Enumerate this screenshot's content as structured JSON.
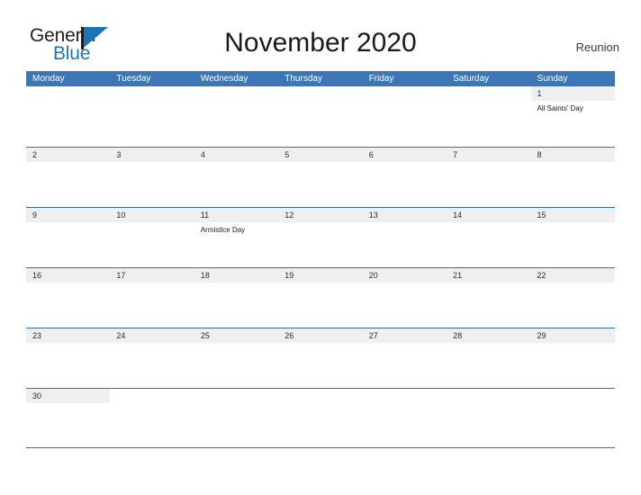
{
  "logo": {
    "word_top": "General",
    "word_bottom": "Blue",
    "sail_icon": "sail-triangle-icon",
    "brand_blue": "#1b75bb"
  },
  "header": {
    "title": "November 2020",
    "locale": "Reunion"
  },
  "theme": {
    "header_blue": "#3b77b8",
    "rule_blue": "#2f6fad",
    "band_gray": "#efefef"
  },
  "calendar": {
    "weekdays": [
      "Monday",
      "Tuesday",
      "Wednesday",
      "Thursday",
      "Friday",
      "Saturday",
      "Sunday"
    ],
    "weeks": [
      [
        {
          "date": "",
          "event": ""
        },
        {
          "date": "",
          "event": ""
        },
        {
          "date": "",
          "event": ""
        },
        {
          "date": "",
          "event": ""
        },
        {
          "date": "",
          "event": ""
        },
        {
          "date": "",
          "event": ""
        },
        {
          "date": "1",
          "event": "All Saints' Day"
        }
      ],
      [
        {
          "date": "2",
          "event": ""
        },
        {
          "date": "3",
          "event": ""
        },
        {
          "date": "4",
          "event": ""
        },
        {
          "date": "5",
          "event": ""
        },
        {
          "date": "6",
          "event": ""
        },
        {
          "date": "7",
          "event": ""
        },
        {
          "date": "8",
          "event": ""
        }
      ],
      [
        {
          "date": "9",
          "event": ""
        },
        {
          "date": "10",
          "event": ""
        },
        {
          "date": "11",
          "event": "Armistice Day"
        },
        {
          "date": "12",
          "event": ""
        },
        {
          "date": "13",
          "event": ""
        },
        {
          "date": "14",
          "event": ""
        },
        {
          "date": "15",
          "event": ""
        }
      ],
      [
        {
          "date": "16",
          "event": ""
        },
        {
          "date": "17",
          "event": ""
        },
        {
          "date": "18",
          "event": ""
        },
        {
          "date": "19",
          "event": ""
        },
        {
          "date": "20",
          "event": ""
        },
        {
          "date": "21",
          "event": ""
        },
        {
          "date": "22",
          "event": ""
        }
      ],
      [
        {
          "date": "23",
          "event": ""
        },
        {
          "date": "24",
          "event": ""
        },
        {
          "date": "25",
          "event": ""
        },
        {
          "date": "26",
          "event": ""
        },
        {
          "date": "27",
          "event": ""
        },
        {
          "date": "28",
          "event": ""
        },
        {
          "date": "29",
          "event": ""
        }
      ],
      [
        {
          "date": "30",
          "event": ""
        },
        {
          "date": "",
          "event": ""
        },
        {
          "date": "",
          "event": ""
        },
        {
          "date": "",
          "event": ""
        },
        {
          "date": "",
          "event": ""
        },
        {
          "date": "",
          "event": ""
        },
        {
          "date": "",
          "event": ""
        }
      ]
    ]
  }
}
